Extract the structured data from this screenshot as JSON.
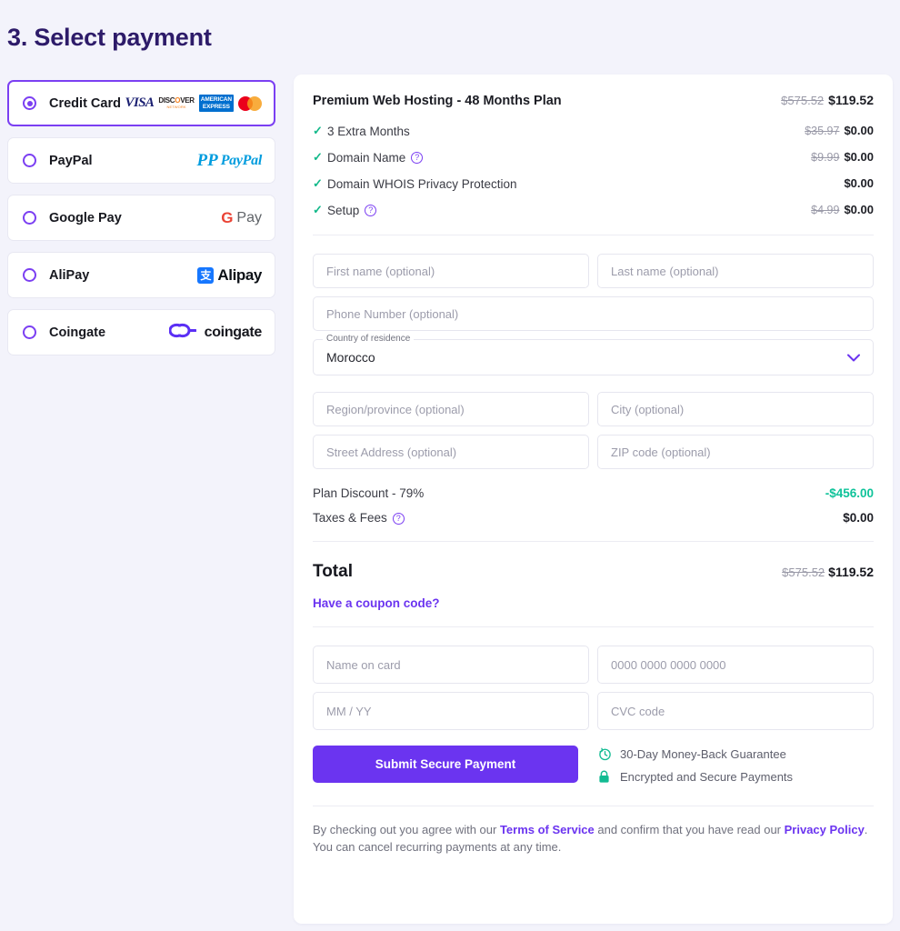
{
  "page": {
    "title": "3. Select payment"
  },
  "payment_methods": [
    {
      "label": "Credit Card",
      "selected": true,
      "logo": "credit-card-brands"
    },
    {
      "label": "PayPal",
      "selected": false,
      "logo": "paypal-logo"
    },
    {
      "label": "Google Pay",
      "selected": false,
      "logo": "google-pay-logo"
    },
    {
      "label": "AliPay",
      "selected": false,
      "logo": "alipay-logo"
    },
    {
      "label": "Coingate",
      "selected": false,
      "logo": "coingate-logo"
    }
  ],
  "card_brands": {
    "visa": "VISA",
    "discover_name": "DISC",
    "discover_o": "O",
    "discover_rest": "VER",
    "discover_sub": "NETWORK",
    "amex_line1": "AMERICAN",
    "amex_line2": "EXPRESS"
  },
  "brand_text": {
    "paypal_p": "P",
    "paypal_pay": "Pay",
    "paypal_pal": "Pal",
    "g_blue": "G",
    "gpay_word": "Pay",
    "alipay_mark": "支",
    "alipay_word": "Alipay",
    "coingate_word": "coingate"
  },
  "order": {
    "plan_name": "Premium Web Hosting - 48 Months Plan",
    "plan_old_price": "$575.52",
    "plan_new_price": "$119.52",
    "features": [
      {
        "label": "3 Extra Months",
        "help": false,
        "old_price": "$35.97",
        "new_price": "$0.00"
      },
      {
        "label": "Domain Name",
        "help": true,
        "old_price": "$9.99",
        "new_price": "$0.00"
      },
      {
        "label": "Domain WHOIS Privacy Protection",
        "help": false,
        "old_price": "",
        "new_price": "$0.00"
      },
      {
        "label": "Setup",
        "help": true,
        "old_price": "$4.99",
        "new_price": "$0.00"
      }
    ],
    "check_glyph": "✓",
    "help_glyph": "?"
  },
  "billing_form": {
    "first_name_placeholder": "First name (optional)",
    "last_name_placeholder": "Last name (optional)",
    "phone_placeholder": "Phone Number (optional)",
    "country_legend": "Country of residence",
    "country_value": "Morocco",
    "region_placeholder": "Region/province (optional)",
    "city_placeholder": "City (optional)",
    "street_placeholder": "Street Address (optional)",
    "zip_placeholder": "ZIP code (optional)"
  },
  "summary": {
    "discount_label": "Plan Discount - 79%",
    "discount_value": "-$456.00",
    "taxes_label": "Taxes & Fees",
    "taxes_value": "$0.00",
    "total_label": "Total",
    "total_old": "$575.52",
    "total_new": "$119.52",
    "coupon_link": "Have a coupon code?"
  },
  "card_form": {
    "name_placeholder": "Name on card",
    "number_placeholder": "0000 0000 0000 0000",
    "expiry_placeholder": "MM / YY",
    "cvc_placeholder": "CVC code"
  },
  "actions": {
    "submit_label": "Submit Secure Payment",
    "badges": [
      {
        "icon": "clock-refresh-icon",
        "text": "30-Day Money-Back Guarantee"
      },
      {
        "icon": "lock-icon",
        "text": "Encrypted and Secure Payments"
      }
    ]
  },
  "legal": {
    "part1": "By checking out you agree with our ",
    "terms": "Terms of Service",
    "part2": " and confirm that you have read our ",
    "privacy": "Privacy Policy",
    "part3": ". You can cancel recurring payments at any time."
  },
  "colors": {
    "accent": "#6b34f0",
    "heading": "#2d1b69",
    "success": "#12bb92",
    "page_bg": "#f3f3fb"
  }
}
